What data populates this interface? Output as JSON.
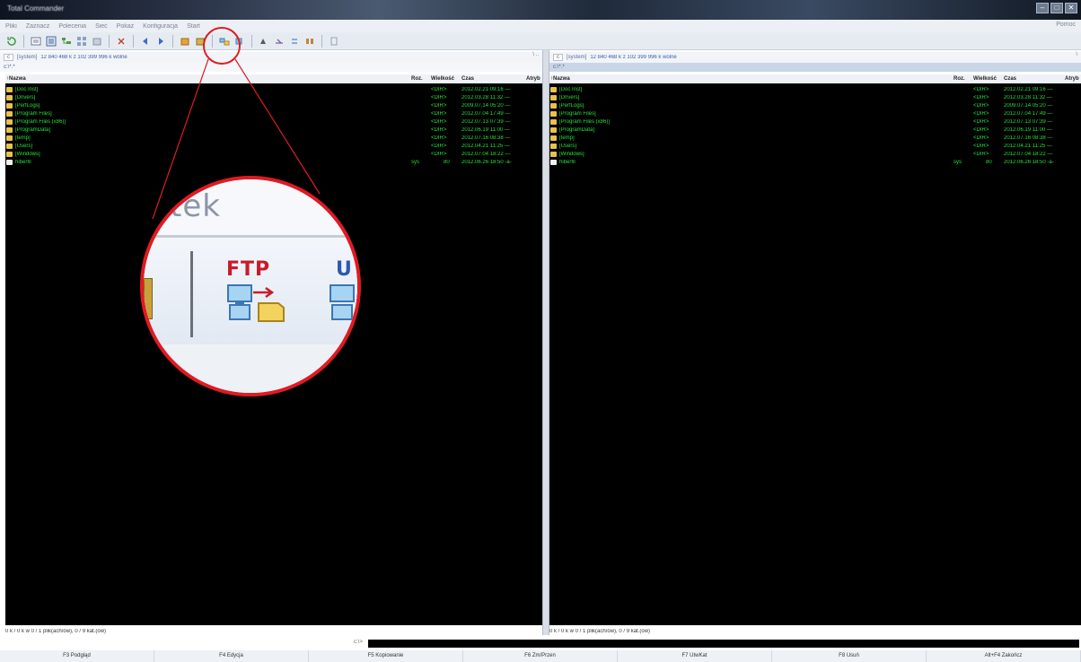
{
  "window": {
    "title": "Total Commander",
    "buttons": [
      "–",
      "□",
      "✕"
    ]
  },
  "menu": {
    "items": [
      "Pliki",
      "Zaznacz",
      "Polecenia",
      "Sieć",
      "Pokaż",
      "Konfiguracja",
      "Start"
    ],
    "help": "Pomoc"
  },
  "toolbar": {
    "buttons": [
      "refresh-icon",
      "brief-icon",
      "detailed-icon",
      "tree-icon",
      "thumbnails-icon",
      "sort-icon",
      "invert-icon",
      "back-icon",
      "forward-icon",
      "pack-icon",
      "unpack-icon",
      "ftp-connect-icon",
      "ftp-url-icon",
      "find-icon",
      "rename-icon",
      "sync-icon",
      "compare-icon",
      "notepad-icon"
    ]
  },
  "left_drive": {
    "drive": "c",
    "label": "[system]",
    "free": "12 840 468 k z 102 399 996 k wolne",
    "path": "c:\\*.*",
    "nav": "\\ .."
  },
  "right_drive": {
    "drive": "c",
    "label": "[system]",
    "free": "12 840 468 k z 102 399 996 k wolne",
    "path": "c:\\*.*",
    "nav": "\\"
  },
  "columns": {
    "name": "↑Nazwa",
    "ext": "Roz.",
    "size": "Wielkość",
    "date": "Czas",
    "attr": "Atryb"
  },
  "left_files": [
    {
      "name": "[Doc Inst]",
      "ext": "",
      "size": "<DIR>",
      "date": "2012.02.21 09:16 —"
    },
    {
      "name": "[Drivers]",
      "ext": "",
      "size": "<DIR>",
      "date": "2012.03.28 11:32 —"
    },
    {
      "name": "[PerfLogs]",
      "ext": "",
      "size": "<DIR>",
      "date": "2009.07.14 05:20 —"
    },
    {
      "name": "[Program Files]",
      "ext": "",
      "size": "<DIR>",
      "date": "2012.07.04 17:49 —"
    },
    {
      "name": "[Program Files (x86)]",
      "ext": "",
      "size": "<DIR>",
      "date": "2012.07.13 07:39 —"
    },
    {
      "name": "[ProgramData]",
      "ext": "",
      "size": "<DIR>",
      "date": "2012.06.19 11:00 —"
    },
    {
      "name": "[temp]",
      "ext": "",
      "size": "<DIR>",
      "date": "2012.07.16 08:38 —"
    },
    {
      "name": "[Users]",
      "ext": "",
      "size": "<DIR>",
      "date": "2012.04.21 11:25 —"
    },
    {
      "name": "[Windows]",
      "ext": "",
      "size": "<DIR>",
      "date": "2012.07.04 18:22 —"
    },
    {
      "name": "hiberfil",
      "ext": "sys",
      "size": "80",
      "date": "2012.06.26 18:50 -a-"
    }
  ],
  "right_files": [
    {
      "name": "[Doc Inst]",
      "ext": "",
      "size": "<DIR>",
      "date": "2012.02.21 09:16 —"
    },
    {
      "name": "[Drivers]",
      "ext": "",
      "size": "<DIR>",
      "date": "2012.03.28 11:32 —"
    },
    {
      "name": "[PerfLogs]",
      "ext": "",
      "size": "<DIR>",
      "date": "2009.07.14 05:20 —"
    },
    {
      "name": "[Program Files]",
      "ext": "",
      "size": "<DIR>",
      "date": "2012.07.04 17:49 —"
    },
    {
      "name": "[Program Files (x86)]",
      "ext": "",
      "size": "<DIR>",
      "date": "2012.07.13 07:39 —"
    },
    {
      "name": "[ProgramData]",
      "ext": "",
      "size": "<DIR>",
      "date": "2012.06.19 11:00 —"
    },
    {
      "name": "[temp]",
      "ext": "",
      "size": "<DIR>",
      "date": "2012.07.16 08:38 —"
    },
    {
      "name": "[Users]",
      "ext": "",
      "size": "<DIR>",
      "date": "2012.04.21 11:25 —"
    },
    {
      "name": "[Windows]",
      "ext": "",
      "size": "<DIR>",
      "date": "2012.07.04 18:22 —"
    },
    {
      "name": "hiberfil",
      "ext": "sys",
      "size": "80",
      "date": "2012.06.26 18:50 -a-"
    }
  ],
  "status": {
    "left": "0 k / 0 k w 0 / 1 plik(ach/ów), 0 / 9 kat.(ów)",
    "right": "0 k / 0 k w 0 / 1 plik(ach/ów), 0 / 9 kat.(ów)"
  },
  "cmdline": {
    "prompt": "c:\\>"
  },
  "fkeys": [
    "F3 Podgląd",
    "F4 Edycja",
    "F5 Kopiowanie",
    "F6 Zm/Przen",
    "F7 UtwKat",
    "F8 Usuń",
    "Alt+F4 Zakończ"
  ],
  "magnifier": {
    "text": "ıgtek",
    "ftp_label": "FTP",
    "url_label": "U"
  },
  "colors": {
    "file_text": "#27e03a",
    "panel_bg": "#000000",
    "callout": "#e01a22"
  }
}
